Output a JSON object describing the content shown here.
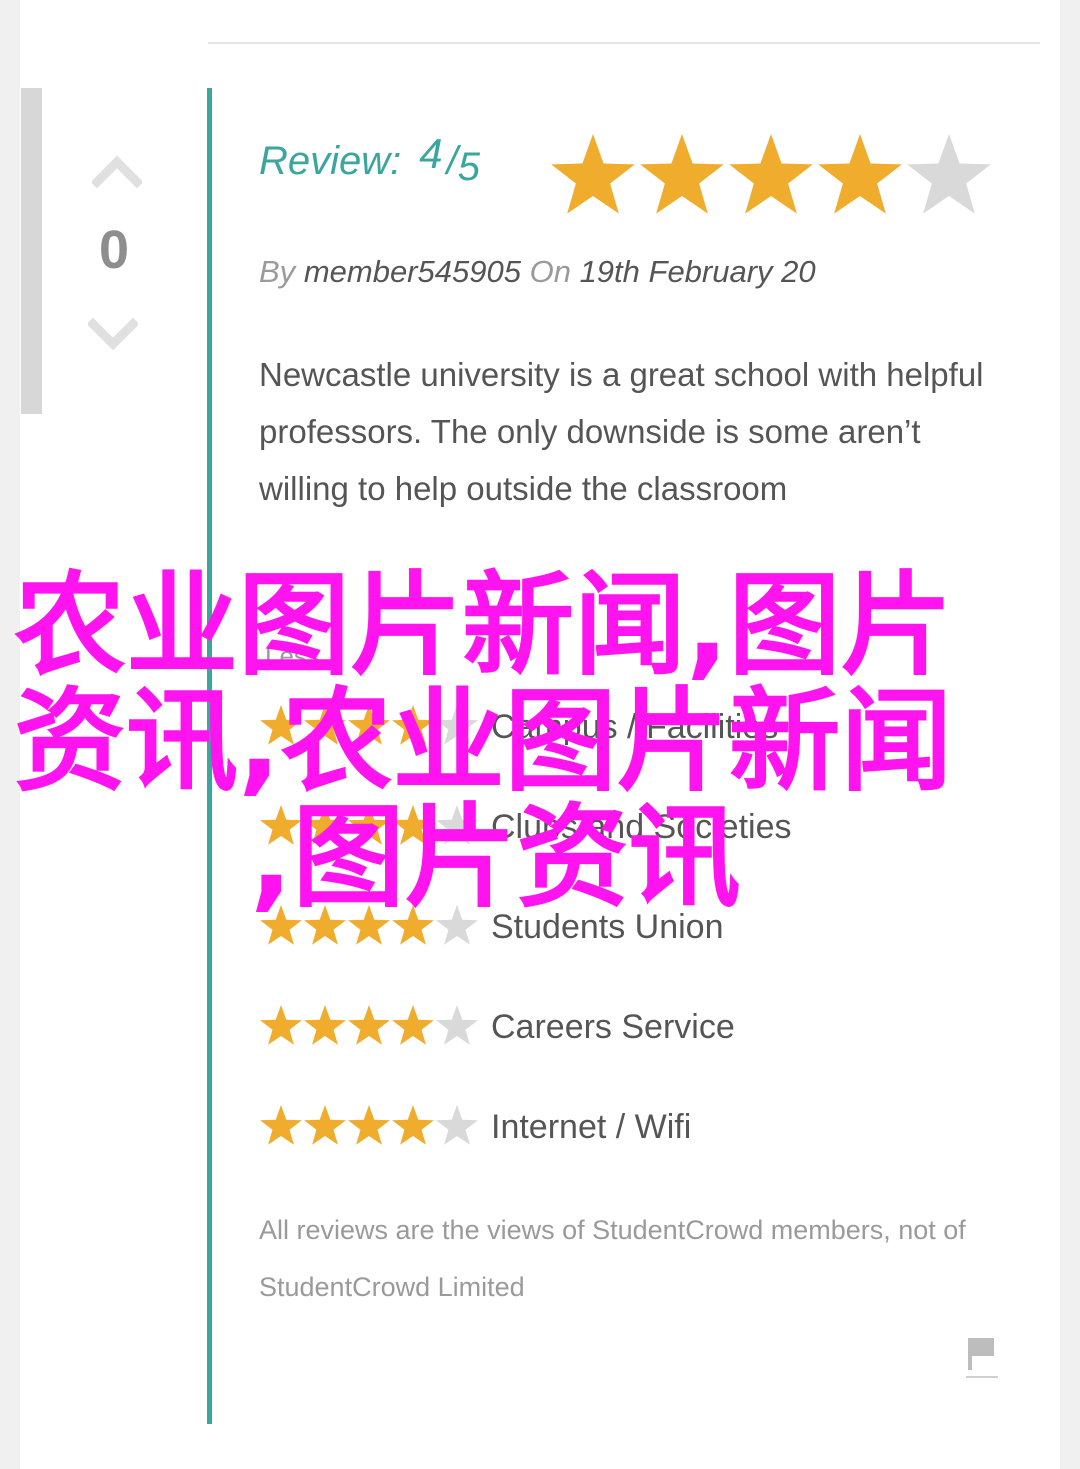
{
  "review": {
    "label": "Review:",
    "score": "4",
    "slash": "/",
    "max": "5",
    "rating": 4,
    "by_label": "By",
    "author": "member545905",
    "on_label": "On",
    "date": "19th February 20",
    "body": "Newcastle university is a great school with helpful professors. The only downside is some aren’t willing to help outside the classroom"
  },
  "votes": {
    "count": "0",
    "up_icon": "chevron-up-icon",
    "down_icon": "chevron-down-icon"
  },
  "toggle_link": "Less",
  "categories": [
    {
      "name": "Campus / Facilities",
      "rating": 4
    },
    {
      "name": "Clubs and Societies",
      "rating": 4
    },
    {
      "name": "Students Union",
      "rating": 4
    },
    {
      "name": "Careers Service",
      "rating": 4
    },
    {
      "name": "Internet / Wifi",
      "rating": 4
    }
  ],
  "disclaimer": "All reviews are the views of StudentCrowd members, not of StudentCrowd Limited",
  "report": {
    "icon": "flag-icon"
  },
  "watermark": {
    "lines": [
      "农业图片新闻,图片",
      "资讯,农业图片新闻",
      ",图片资讯"
    ]
  },
  "colors": {
    "accent": "#3aa69e",
    "star_on": "#f0ac2c",
    "star_off": "#d9d9d9",
    "watermark": "#ff14f0",
    "text": "#555555",
    "muted": "#9a9a9a"
  }
}
